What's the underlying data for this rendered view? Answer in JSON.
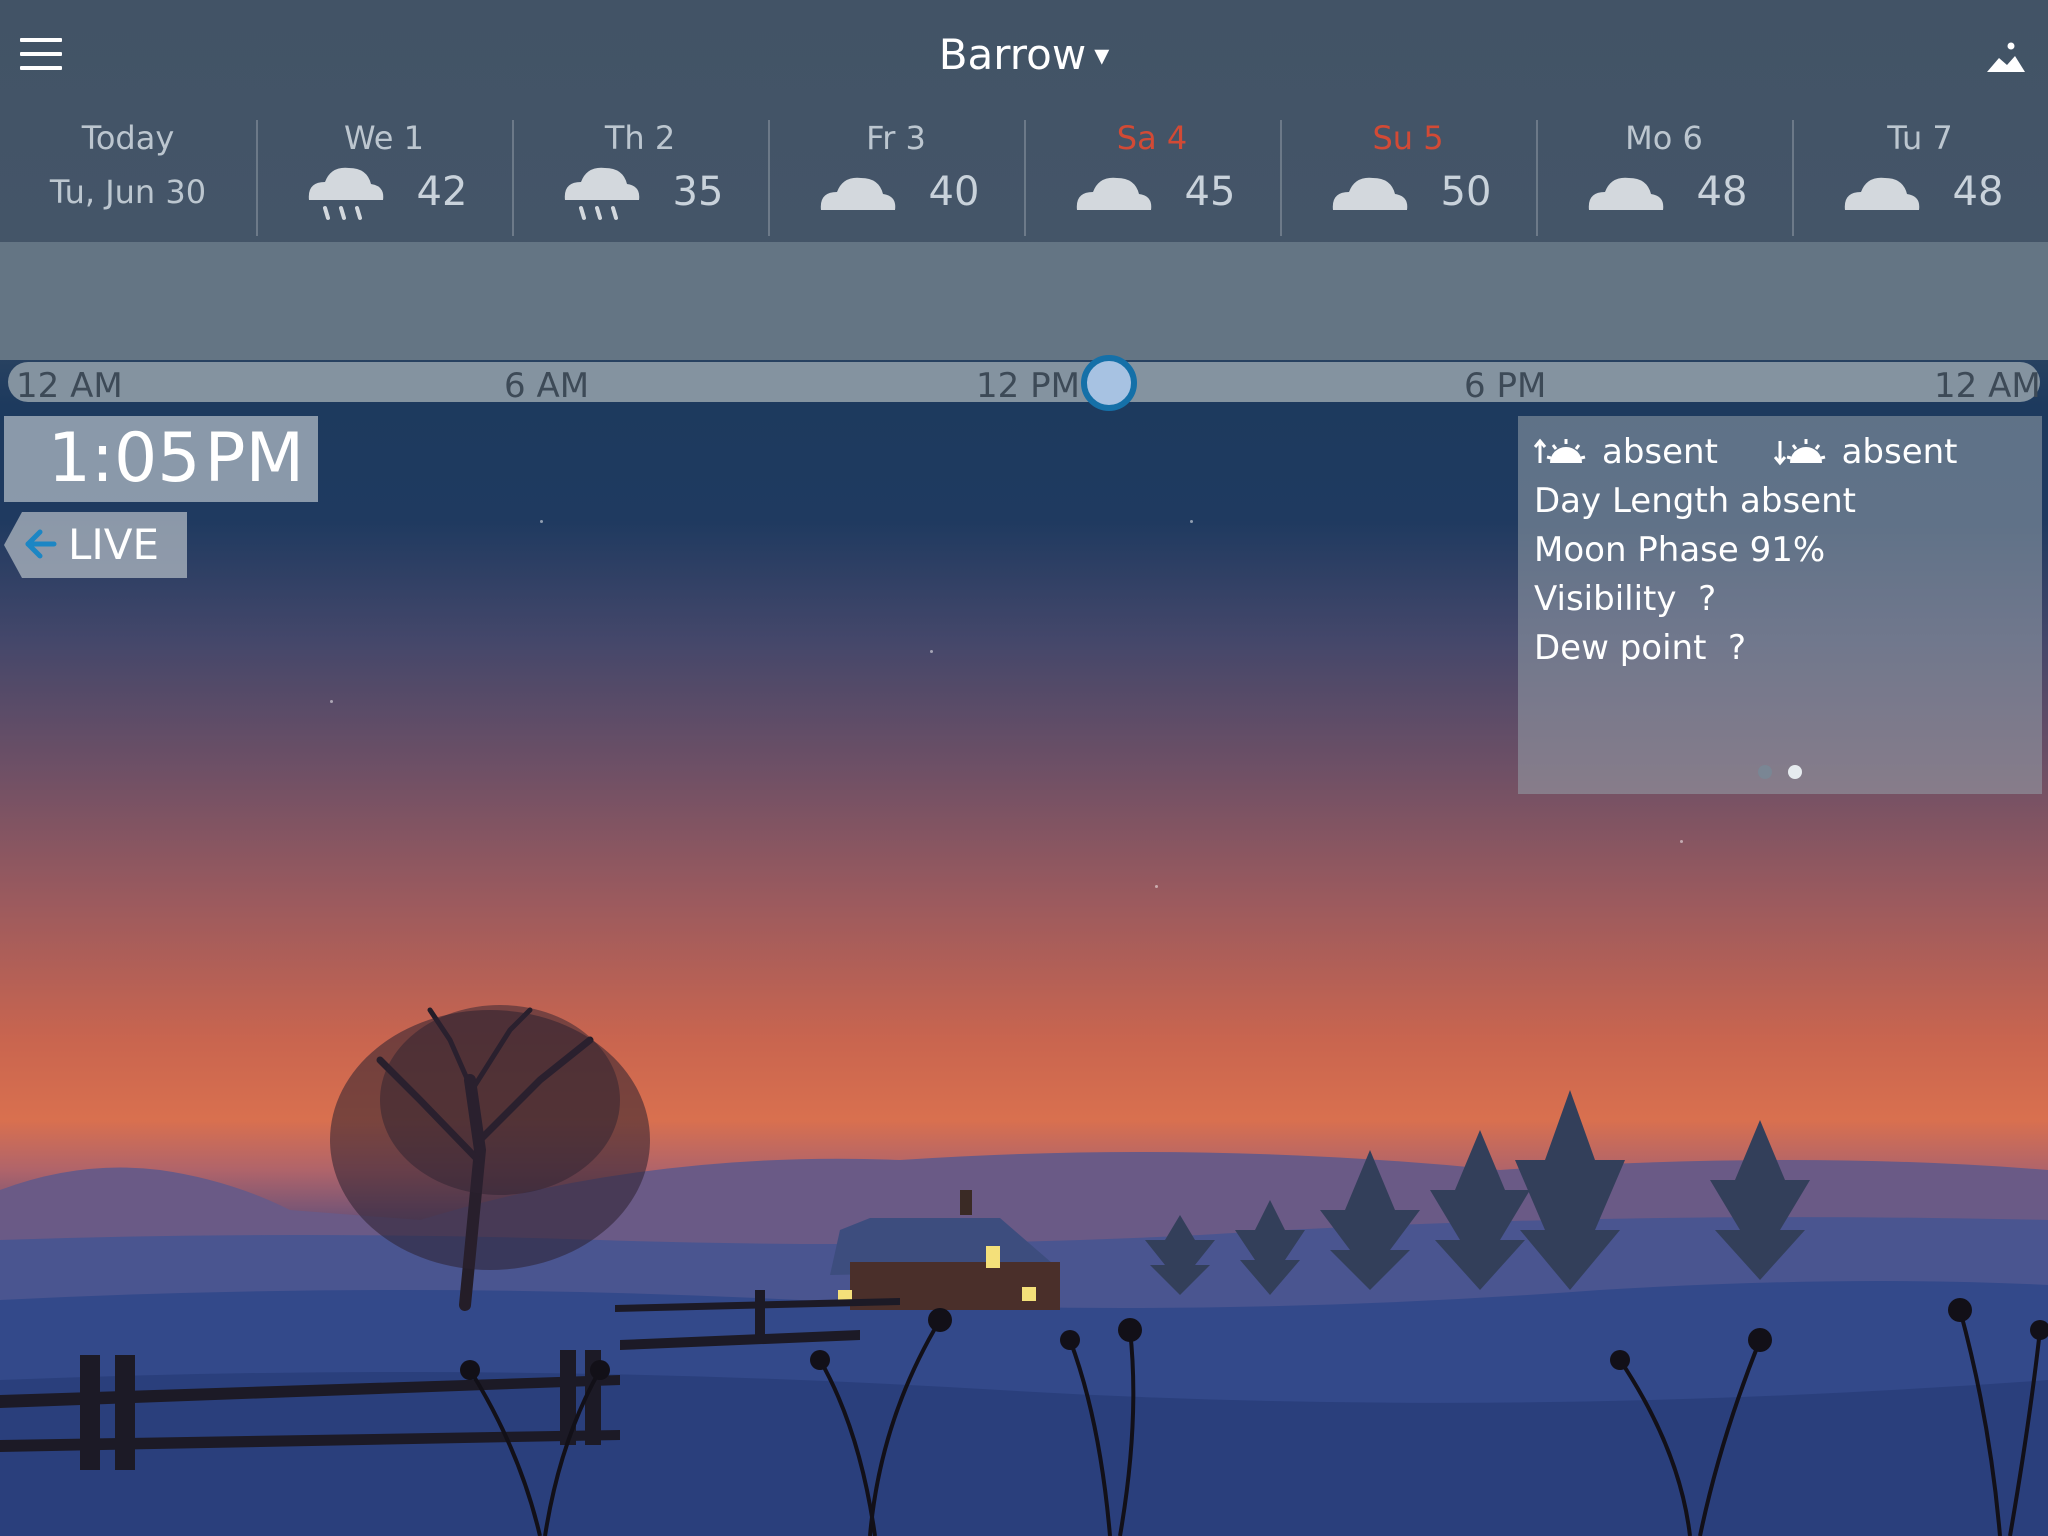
{
  "header": {
    "location": "Barrow",
    "location_caret": "▾"
  },
  "forecast": {
    "today": {
      "label": "Today",
      "date": "Tu, Jun 30"
    },
    "days": [
      {
        "name": "We 1",
        "icon": "rain-cloud-icon",
        "temp": "42",
        "weekend": false
      },
      {
        "name": "Th 2",
        "icon": "rain-cloud-icon",
        "temp": "35",
        "weekend": false
      },
      {
        "name": "Fr 3",
        "icon": "cloud-icon",
        "temp": "40",
        "weekend": false
      },
      {
        "name": "Sa 4",
        "icon": "cloud-icon",
        "temp": "45",
        "weekend": true
      },
      {
        "name": "Su 5",
        "icon": "cloud-icon",
        "temp": "50",
        "weekend": true
      },
      {
        "name": "Mo 6",
        "icon": "cloud-icon",
        "temp": "48",
        "weekend": false
      },
      {
        "name": "Tu 7",
        "icon": "cloud-icon",
        "temp": "48",
        "weekend": false
      }
    ]
  },
  "timeline": {
    "ticks": [
      "12 AM",
      "6 AM",
      "12 PM",
      "6 PM",
      "12 AM"
    ],
    "position_hours": 13.08
  },
  "clock": {
    "time": "1:05",
    "ampm": "PM"
  },
  "live": {
    "label": "LIVE"
  },
  "info": {
    "sunrise": "absent",
    "sunset": "absent",
    "day_length": "Day Length absent",
    "moon_phase": "Moon Phase 91%",
    "visibility": "Visibility  ?",
    "dew_point": "Dew point  ?",
    "page_count": 2,
    "active_page": 2
  },
  "colors": {
    "weekend": "#d24a35",
    "knob_ring": "#1570a8",
    "knob_fill": "#a7c2e2"
  }
}
